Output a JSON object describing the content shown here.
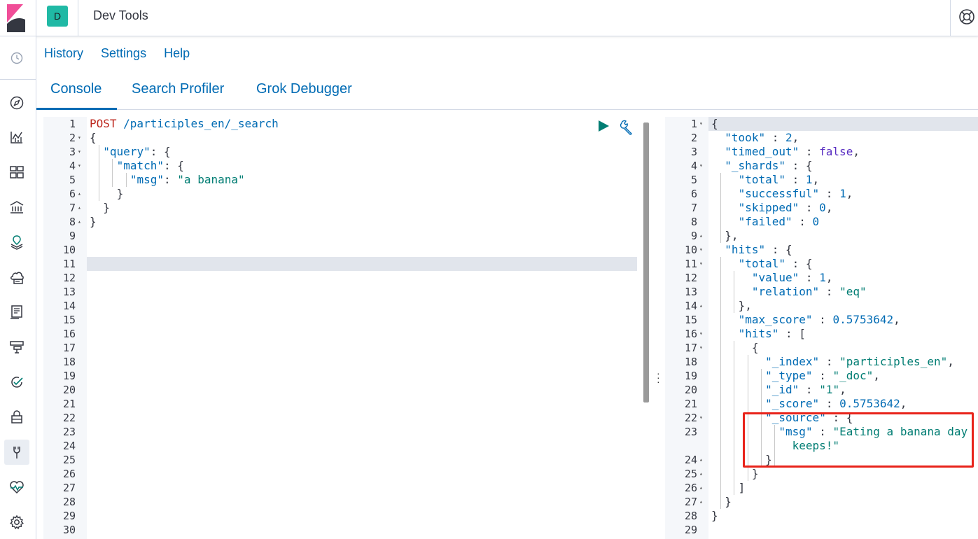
{
  "app": {
    "title": "Dev Tools",
    "avatar_initial": "D"
  },
  "menu": {
    "history": "History",
    "settings": "Settings",
    "help": "Help"
  },
  "tabs": [
    {
      "label": "Console",
      "active": true
    },
    {
      "label": "Search Profiler",
      "active": false
    },
    {
      "label": "Grok Debugger",
      "active": false
    }
  ],
  "nav_icons": [
    "clock-icon",
    "discover-icon",
    "visualize-icon",
    "dashboard-icon",
    "canvas-icon",
    "maps-icon",
    "infrastructure-icon",
    "logs-icon",
    "apm-icon",
    "uptime-icon",
    "security-icon",
    "dev-tools-icon",
    "monitoring-icon",
    "management-icon"
  ],
  "request": {
    "method": "POST",
    "path": " /participles_en/_search",
    "line_count": 30,
    "active_line": 11,
    "fold_lines": {
      "2": "down",
      "3": "down",
      "4": "down",
      "6": "up",
      "7": "up",
      "8": "up"
    },
    "lines": [
      "",
      "{",
      "  \"query\": {",
      "    \"match\": {",
      "      \"msg\": \"a banana\"",
      "    }",
      "  }",
      "}"
    ]
  },
  "response": {
    "line_labels": [
      "1",
      "2",
      "3",
      "4",
      "5",
      "6",
      "7",
      "8",
      "9",
      "10",
      "11",
      "12",
      "13",
      "14",
      "15",
      "16",
      "17",
      "18",
      "19",
      "20",
      "21",
      "22",
      "23",
      "",
      "24",
      "25",
      "26",
      "27",
      "28",
      "29"
    ],
    "fold_lines": {
      "1": "down",
      "4": "down",
      "9": "up",
      "10": "down",
      "11": "down",
      "14": "up",
      "16": "down",
      "17": "down",
      "22": "down",
      "24": "up",
      "25": "up",
      "26": "up",
      "27": "up"
    },
    "lines": [
      "{",
      "  \"took\" : 2,",
      "  \"timed_out\" : false,",
      "  \"_shards\" : {",
      "    \"total\" : 1,",
      "    \"successful\" : 1,",
      "    \"skipped\" : 0,",
      "    \"failed\" : 0",
      "  },",
      "  \"hits\" : {",
      "    \"total\" : {",
      "      \"value\" : 1,",
      "      \"relation\" : \"eq\"",
      "    },",
      "    \"max_score\" : 0.5753642,",
      "    \"hits\" : [",
      "      {",
      "        \"_index\" : \"participles_en\",",
      "        \"_type\" : \"_doc\",",
      "        \"_id\" : \"1\",",
      "        \"_score\" : 0.5753642,",
      "        \"_source\" : {",
      "          \"msg\" : \"Eating a banana day",
      "            keeps!\"",
      "        }",
      "      }",
      "    ]",
      "  }",
      "}",
      ""
    ]
  },
  "colors": {
    "accent": "#006bb4",
    "string": "#017d73",
    "method": "#bd271e",
    "boolean": "#5a2fc2",
    "highlight_box": "#e8231a",
    "run": "#017d73"
  }
}
